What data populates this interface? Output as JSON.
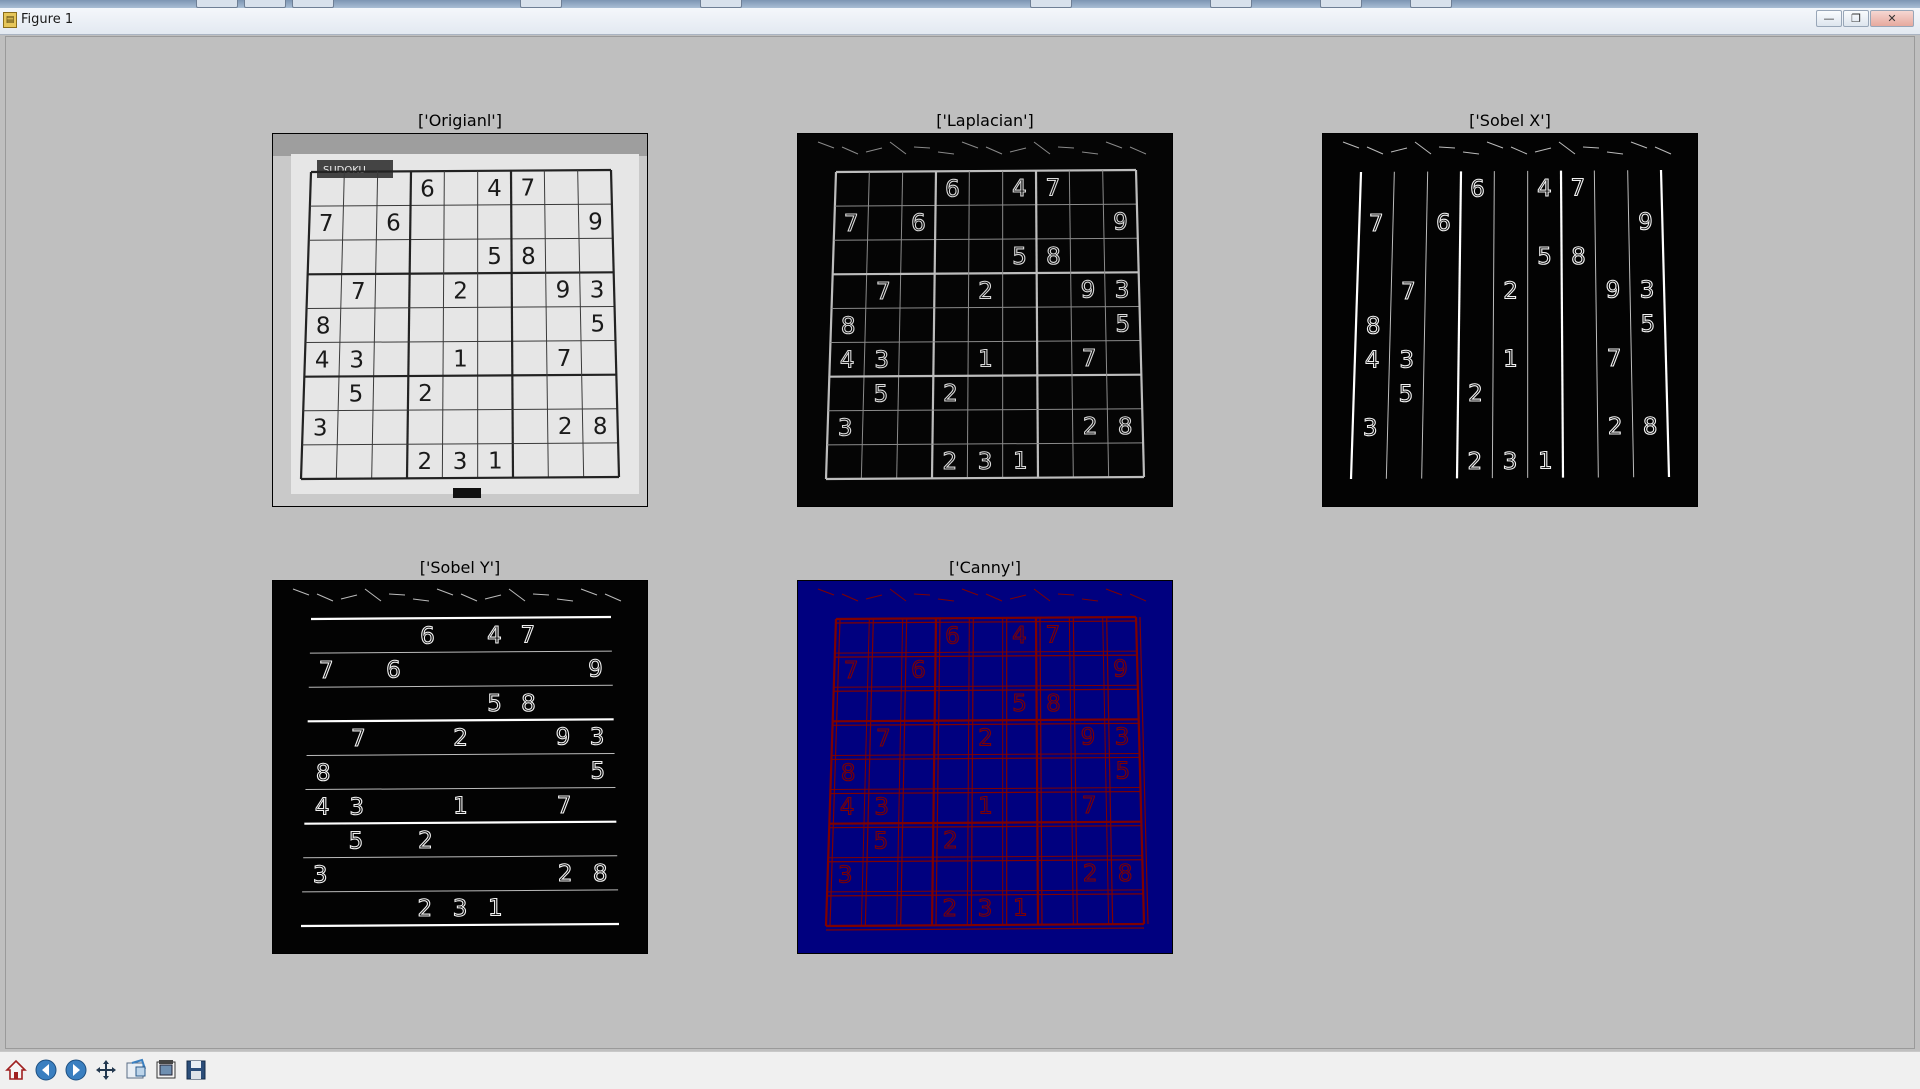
{
  "window": {
    "title": "Figure 1",
    "icon": "matplotlib-figure-icon",
    "controls": [
      "minimize-icon",
      "maximize-icon",
      "close-icon"
    ]
  },
  "subplots": [
    {
      "id": "original",
      "title": "['Origianl']",
      "style": "grayscale-photo"
    },
    {
      "id": "laplacian",
      "title": "['Laplacian']",
      "style": "edge-dark"
    },
    {
      "id": "sobel-x",
      "title": "['Sobel X']",
      "style": "edge-vertical"
    },
    {
      "id": "sobel-y",
      "title": "['Sobel Y']",
      "style": "edge-horizontal"
    },
    {
      "id": "canny",
      "title": "['Canny']",
      "style": "canny-colormap"
    }
  ],
  "sudoku": {
    "cells": [
      {
        "r": 0,
        "c": 3,
        "v": "6"
      },
      {
        "r": 0,
        "c": 5,
        "v": "4"
      },
      {
        "r": 0,
        "c": 6,
        "v": "7"
      },
      {
        "r": 1,
        "c": 0,
        "v": "7"
      },
      {
        "r": 1,
        "c": 2,
        "v": "6"
      },
      {
        "r": 1,
        "c": 8,
        "v": "9"
      },
      {
        "r": 2,
        "c": 5,
        "v": "5"
      },
      {
        "r": 2,
        "c": 6,
        "v": "8"
      },
      {
        "r": 3,
        "c": 1,
        "v": "7"
      },
      {
        "r": 3,
        "c": 4,
        "v": "2"
      },
      {
        "r": 3,
        "c": 7,
        "v": "9"
      },
      {
        "r": 3,
        "c": 8,
        "v": "3"
      },
      {
        "r": 4,
        "c": 0,
        "v": "8"
      },
      {
        "r": 4,
        "c": 8,
        "v": "5"
      },
      {
        "r": 5,
        "c": 0,
        "v": "4"
      },
      {
        "r": 5,
        "c": 1,
        "v": "3"
      },
      {
        "r": 5,
        "c": 4,
        "v": "1"
      },
      {
        "r": 5,
        "c": 7,
        "v": "7"
      },
      {
        "r": 6,
        "c": 1,
        "v": "5"
      },
      {
        "r": 6,
        "c": 3,
        "v": "2"
      },
      {
        "r": 7,
        "c": 0,
        "v": "3"
      },
      {
        "r": 7,
        "c": 7,
        "v": "2"
      },
      {
        "r": 7,
        "c": 8,
        "v": "8"
      },
      {
        "r": 8,
        "c": 3,
        "v": "2"
      },
      {
        "r": 8,
        "c": 4,
        "v": "3"
      },
      {
        "r": 8,
        "c": 5,
        "v": "1"
      }
    ],
    "header_label": "SUDOKU"
  },
  "colors": {
    "canvas_bg": "#bfbfbf",
    "canny_bg": "#00007f",
    "canny_edge": "#7f0000"
  },
  "toolbar": {
    "tools": [
      {
        "name": "home-icon",
        "tooltip": "Reset original view"
      },
      {
        "name": "back-icon",
        "tooltip": "Back to previous view"
      },
      {
        "name": "forward-icon",
        "tooltip": "Forward to next view"
      },
      {
        "name": "pan-icon",
        "tooltip": "Pan axes"
      },
      {
        "name": "zoom-icon",
        "tooltip": "Zoom to rectangle"
      },
      {
        "name": "subplots-icon",
        "tooltip": "Configure subplots"
      },
      {
        "name": "save-icon",
        "tooltip": "Save the figure"
      }
    ]
  }
}
